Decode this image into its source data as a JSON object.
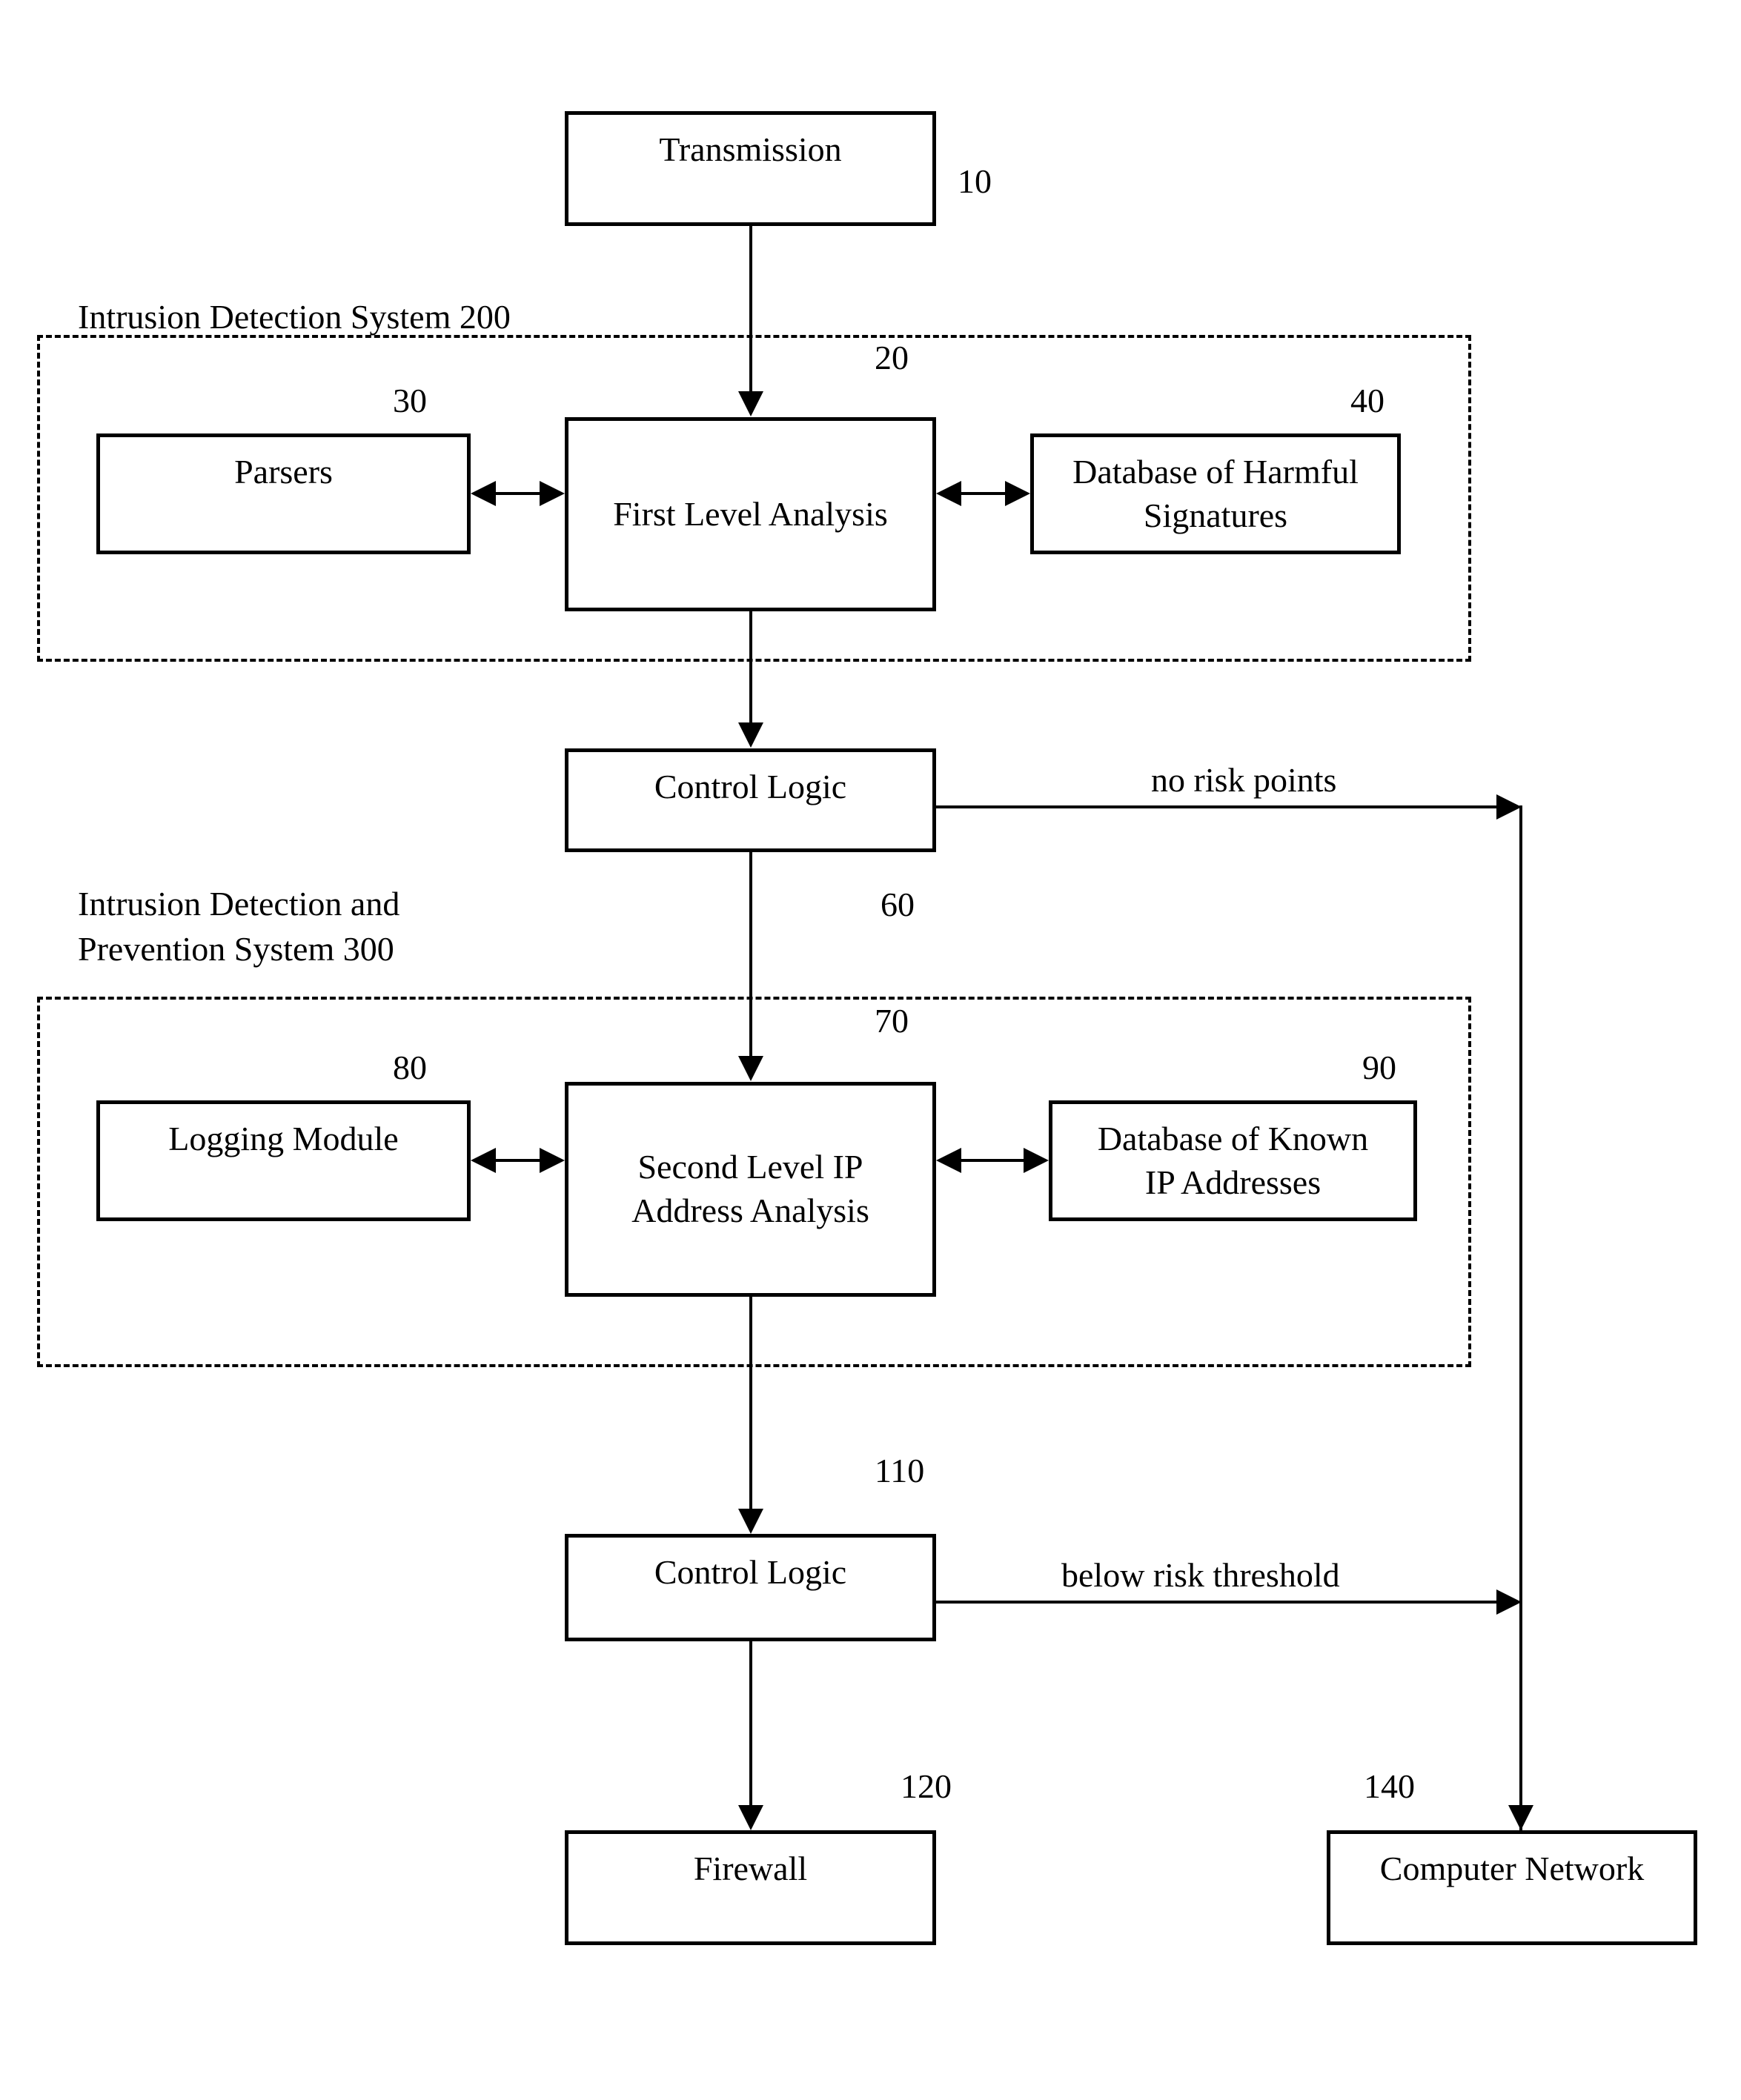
{
  "figure": {
    "type": "patent-flow-diagram",
    "boxes": {
      "transmission": "Transmission",
      "first_level_analysis": "First Level Analysis",
      "parsers": "Parsers",
      "database_harmful_signatures": "Database of Harmful\nSignatures",
      "control_logic_1": "Control Logic",
      "logging_module": "Logging Module",
      "second_level_ip_analysis": "Second Level IP\nAddress Analysis",
      "database_known_ip": "Database of Known\nIP Addresses",
      "control_logic_2": "Control Logic",
      "firewall": "Firewall",
      "computer_network": "Computer Network"
    },
    "containers": {
      "ids_label": "Intrusion Detection System 200",
      "idps_label": "Intrusion Detection and\nPrevention System 300"
    },
    "edge_labels": {
      "no_risk_points": "no risk points",
      "below_risk_threshold": "below risk threshold"
    },
    "numerals": {
      "transmission": "10",
      "first_level_analysis": "20",
      "parsers": "30",
      "database_harmful_signatures": "40",
      "control_logic_1": "60",
      "second_level_ip_analysis": "70",
      "logging_module": "80",
      "database_known_ip": "90",
      "control_logic_2": "110",
      "firewall": "120",
      "computer_network": "140"
    },
    "colors": {
      "stroke": "#000000",
      "background": "#ffffff"
    }
  }
}
